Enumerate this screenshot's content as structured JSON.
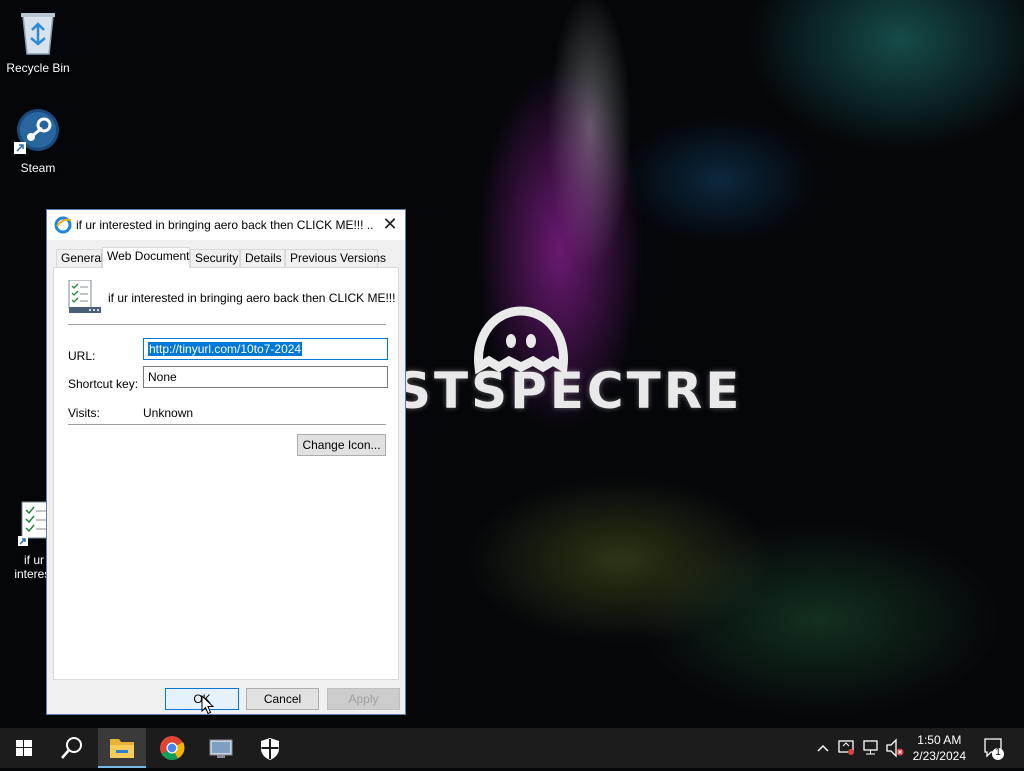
{
  "desktop": {
    "brand_text": "STSPECTRE",
    "icons": [
      {
        "label": "Recycle Bin",
        "icon": "recycle-bin-icon"
      },
      {
        "label": "Steam",
        "icon": "steam-icon"
      },
      {
        "label_line1": "if ur",
        "label_line2": "interest",
        "icon": "web-document-shortcut-icon"
      }
    ]
  },
  "dialog": {
    "title": "if ur interested in bringing aero back then CLICK ME!!! ...",
    "close_label": "✕",
    "tabs": [
      {
        "label": "General",
        "active": false
      },
      {
        "label": "Web Document",
        "active": true
      },
      {
        "label": "Security",
        "active": false
      },
      {
        "label": "Details",
        "active": false
      },
      {
        "label": "Previous Versions",
        "active": false
      }
    ],
    "doc_name": "if ur interested in bringing aero back then CLICK ME!!!",
    "url_label": "URL:",
    "url_value": "http://tinyurl.com/10to7-2024",
    "shortcut_label": "Shortcut key:",
    "shortcut_value": "None",
    "visits_label": "Visits:",
    "visits_value": "Unknown",
    "change_icon_label": "Change Icon...",
    "ok_label": "OK",
    "cancel_label": "Cancel",
    "apply_label": "Apply"
  },
  "taskbar": {
    "pinned": [
      "start-icon",
      "search-icon",
      "file-explorer-icon",
      "chrome-icon",
      "remote-desktop-icon",
      "windows-security-icon"
    ],
    "time": "1:50 AM",
    "date": "2/23/2024",
    "notification_count": "1",
    "accent": "#0078d7"
  }
}
